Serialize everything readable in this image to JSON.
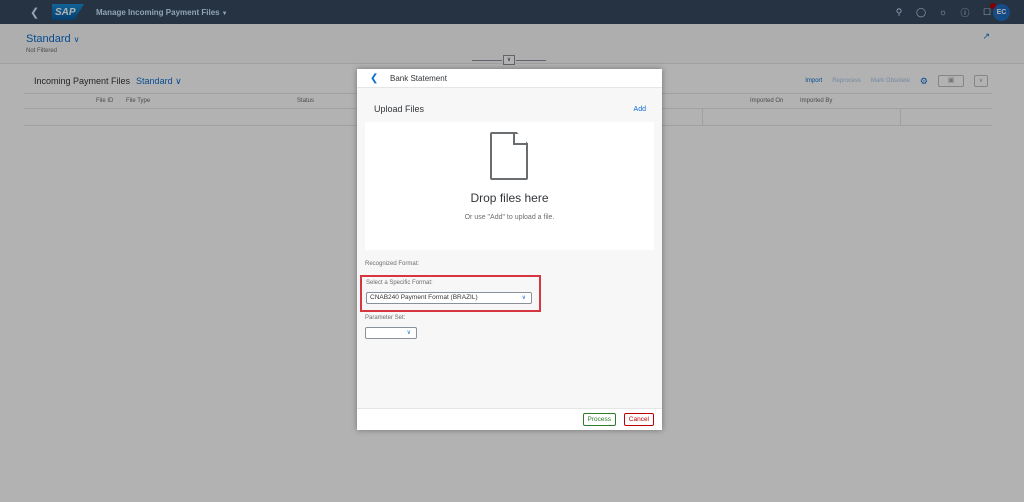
{
  "shell": {
    "logo": "SAP",
    "app_title": "Manage Incoming Payment Files",
    "avatar_initials": "EC"
  },
  "header": {
    "variant": "Standard",
    "filter_status": "Not Filtered"
  },
  "table": {
    "title": "Incoming Payment Files",
    "variant": "Standard",
    "actions": {
      "import": "Import",
      "reprocess": "Reprocess",
      "mark_obsolete": "Mark Obsolete"
    },
    "columns": [
      "File ID",
      "File Type",
      "Status",
      "Imported On",
      "Imported By"
    ]
  },
  "dialog": {
    "title": "Bank Statement",
    "upload_title": "Upload Files",
    "add_label": "Add",
    "drop_title": "Drop files here",
    "drop_subtitle": "Or use \"Add\" to upload a file.",
    "recognized_format_label": "Recognized Format:",
    "specific_format_label": "Select a Specific Format:",
    "specific_format_value": "CNAB240 Payment Format (BRAZIL)",
    "parameter_set_label": "Parameter Set:",
    "parameter_set_value": "",
    "process_label": "Process",
    "cancel_label": "Cancel"
  },
  "colors": {
    "shell_bg": "#354a5f",
    "accent": "#0a6ed1",
    "highlight_box": "#d6363f",
    "process_green": "#2b7d2b",
    "cancel_red": "#bb0000"
  }
}
